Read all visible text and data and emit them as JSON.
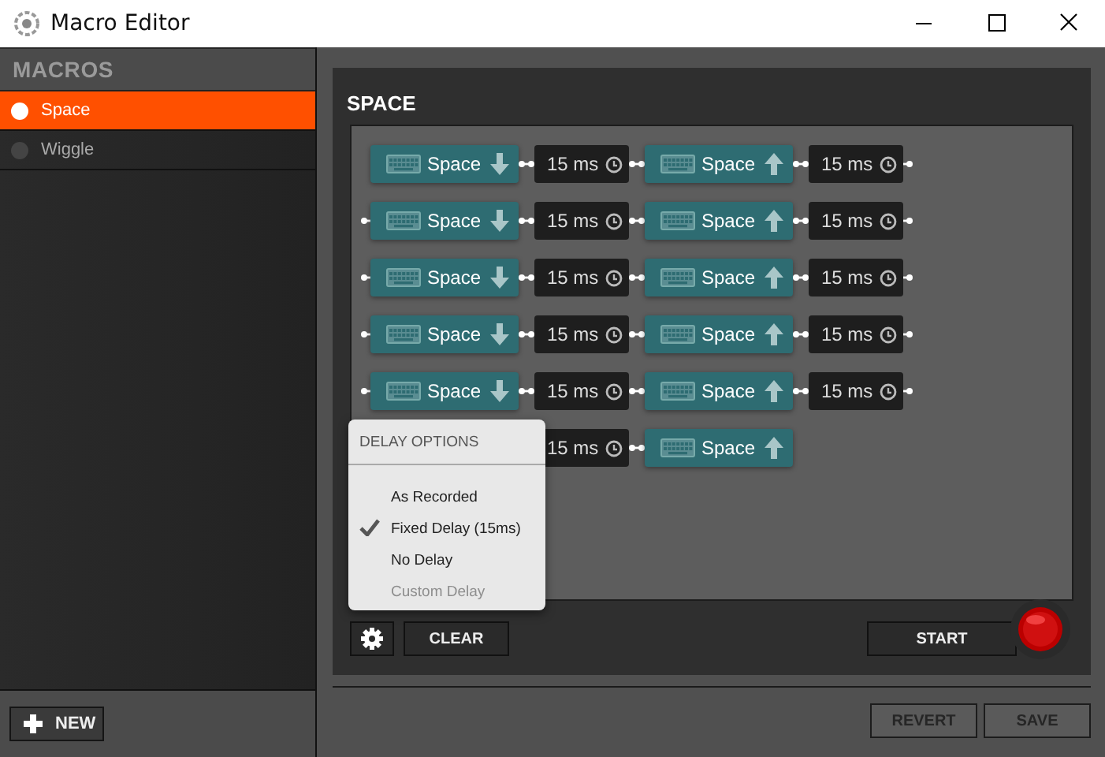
{
  "window": {
    "title": "Macro Editor"
  },
  "sidebar": {
    "header": "MACROS",
    "items": [
      {
        "label": "Space",
        "selected": true
      },
      {
        "label": "Wiggle",
        "selected": false
      }
    ],
    "new_button": "NEW"
  },
  "macro": {
    "title": "SPACE",
    "rows": [
      {
        "linked": false,
        "items": [
          {
            "kind": "key_down",
            "label": "Space"
          },
          {
            "kind": "delay",
            "label": "15 ms"
          },
          {
            "kind": "key_up",
            "label": "Space"
          },
          {
            "kind": "delay",
            "label": "15 ms"
          }
        ]
      },
      {
        "linked": true,
        "items": [
          {
            "kind": "key_down",
            "label": "Space"
          },
          {
            "kind": "delay",
            "label": "15 ms"
          },
          {
            "kind": "key_up",
            "label": "Space"
          },
          {
            "kind": "delay",
            "label": "15 ms"
          }
        ]
      },
      {
        "linked": true,
        "items": [
          {
            "kind": "key_down",
            "label": "Space"
          },
          {
            "kind": "delay",
            "label": "15 ms"
          },
          {
            "kind": "key_up",
            "label": "Space"
          },
          {
            "kind": "delay",
            "label": "15 ms"
          }
        ]
      },
      {
        "linked": true,
        "items": [
          {
            "kind": "key_down",
            "label": "Space"
          },
          {
            "kind": "delay",
            "label": "15 ms"
          },
          {
            "kind": "key_up",
            "label": "Space"
          },
          {
            "kind": "delay",
            "label": "15 ms"
          }
        ]
      },
      {
        "linked": true,
        "items": [
          {
            "kind": "key_down",
            "label": "Space"
          },
          {
            "kind": "delay",
            "label": "15 ms"
          },
          {
            "kind": "key_up",
            "label": "Space"
          },
          {
            "kind": "delay",
            "label": "15 ms"
          }
        ]
      },
      {
        "items": [
          {
            "kind": "covered"
          },
          {
            "kind": "delay",
            "label": "15 ms"
          },
          {
            "kind": "key_up",
            "label": "Space"
          }
        ]
      }
    ],
    "delay_menu": {
      "header": "DELAY OPTIONS",
      "options": [
        {
          "label": "As Recorded",
          "checked": false,
          "disabled": false
        },
        {
          "label": "Fixed Delay (15ms)",
          "checked": true,
          "disabled": false
        },
        {
          "label": "No Delay",
          "checked": false,
          "disabled": false
        },
        {
          "label": "Custom Delay",
          "checked": false,
          "disabled": true
        }
      ]
    },
    "clear_button": "CLEAR",
    "start_button": "START"
  },
  "footer": {
    "buttons": [
      {
        "label": "REVERT",
        "disabled": true
      },
      {
        "label": "SAVE",
        "disabled": true
      }
    ]
  }
}
